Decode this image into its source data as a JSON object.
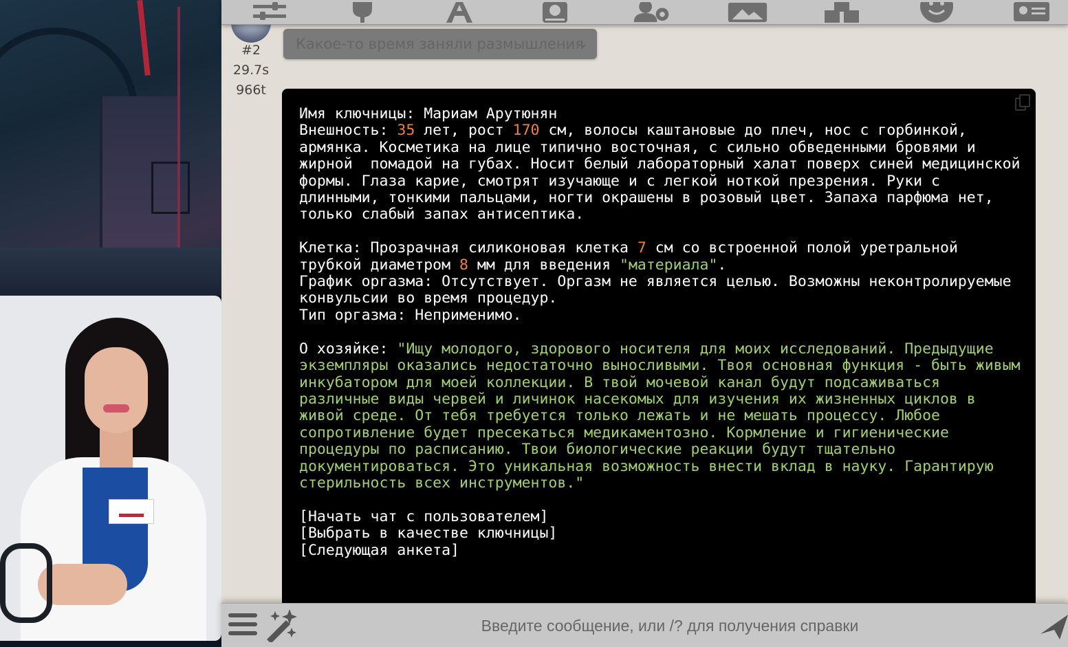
{
  "toolbar": {
    "icons": [
      "sliders-icon",
      "plug-icon",
      "font-icon",
      "book-icon",
      "user-gear-icon",
      "image-icon",
      "cubes-icon",
      "smile-icon",
      "id-card-icon"
    ]
  },
  "message": {
    "index": "#2",
    "time": "29.7s",
    "tokens": "966t",
    "thinking_label": "Какое-то время заняли размышления",
    "lines": {
      "name": "Имя ключницы: Мариам Арутюнян",
      "appearance_prefix": "Внешность: ",
      "age": "35",
      "age_text": " лет, рост ",
      "height": "170",
      "appearance_rest": " см, волосы каштановые до плеч, нос с горбинкой, армянка. Косметика на лице типично восточная, с сильно обведенными бровями и жирной  помадой на губах. Носит белый лабораторный халат поверх синей медицинской формы. Глаза карие, смотрят изучающе и с легкой ноткой презрения. Руки с длинными, тонкими пальцами, ногти окрашены в розовый цвет. Запаха парфюма нет, только слабый запах антисептика.",
      "cage_prefix": "Клетка: Прозрачная силиконовая клетка ",
      "cage_size": "7",
      "cage_mid": " см со встроенной полой уретральной трубкой диаметром ",
      "tube_diameter": "8",
      "cage_mid2": " мм для введения ",
      "cage_quote": "\"материала\"",
      "cage_end": ".",
      "schedule": "График оргазма: Отсутствует. Оргазм не является целью. Возможны неконтролируемые конвульсии во время процедур.",
      "orgasm_type": "Тип оргазма: Неприменимо.",
      "about_prefix": "О хозяйке: ",
      "about_quote": "\"Ищу молодого, здорового носителя для моих исследований. Предыдущие экземпляры оказались недостаточно выносливыми. Твоя основная функция - быть живым инкубатором для моей коллекции. В твой мочевой канал будут подсаживаться различные виды червей и личинок насекомых для изучения их жизненных циклов в живой среде. От тебя требуется только лежать и не мешать процессу. Любое сопротивление будет пресекаться медикаментозно. Кормление и гигиенические процедуры по расписанию. Твои биологические реакции будут тщательно документироваться. Это уникальная возможность внести вклад в науку. Гарантирую стерильность всех инструментов.\"",
      "option1": "[Начать чат с пользователем]",
      "option2": "[Выбрать в качестве ключницы]",
      "option3": "[Следующая анкета]"
    }
  },
  "input": {
    "placeholder": "Введите сообщение, или /? для получения справки"
  },
  "colors": {
    "number": "#f0813a",
    "string": "#9fcf6e",
    "code_bg": "#000000",
    "chat_bg": "#e2ddd6"
  }
}
